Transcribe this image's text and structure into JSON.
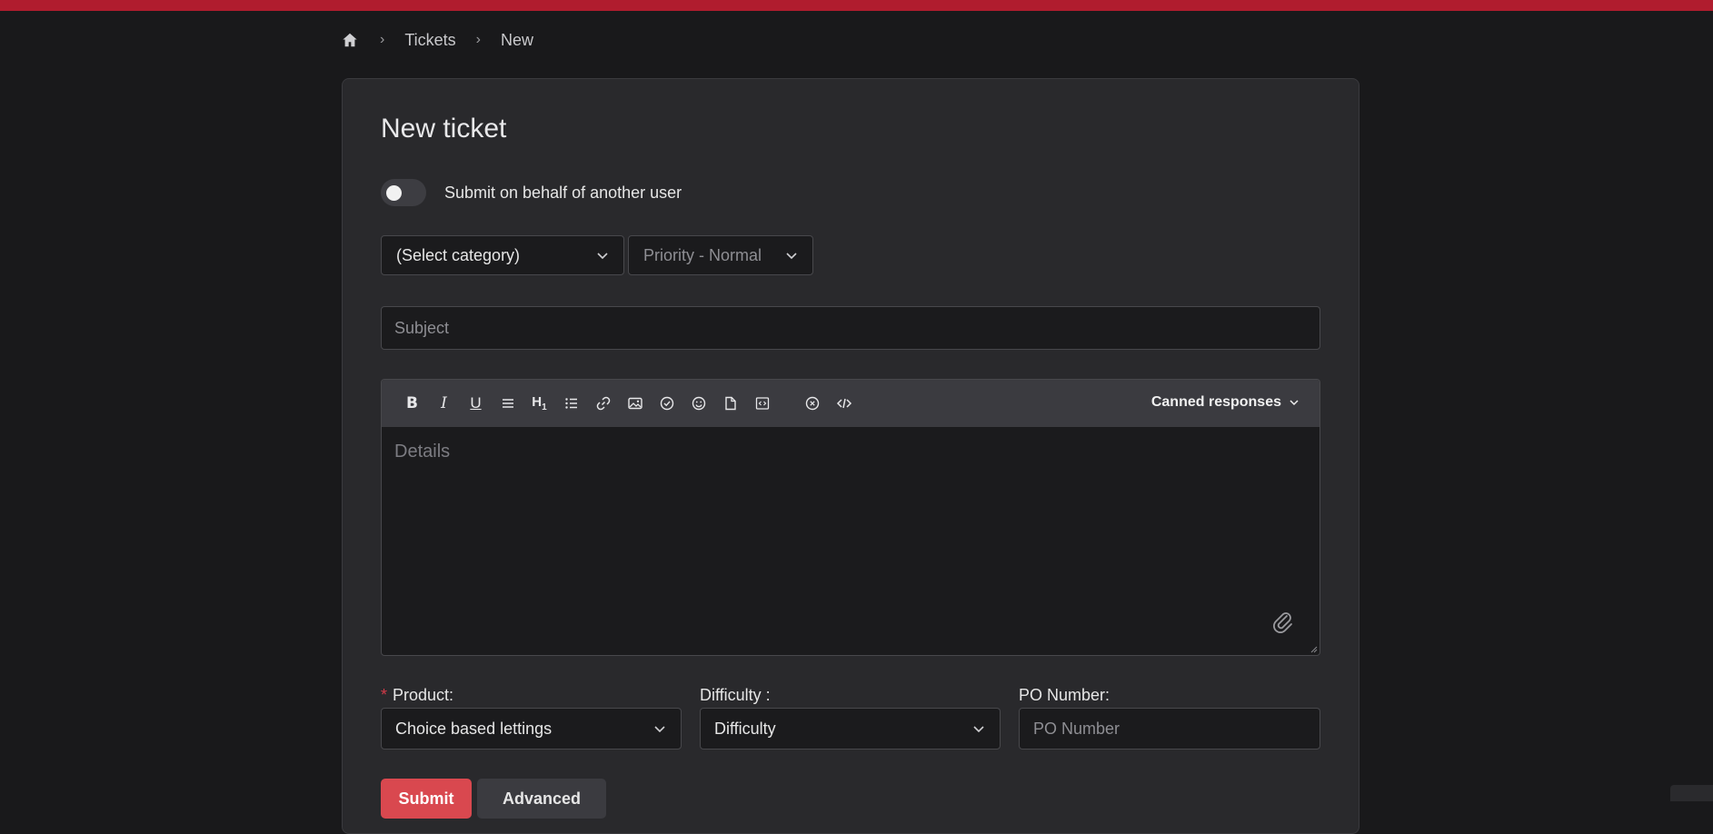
{
  "breadcrumb": {
    "items": [
      "Tickets",
      "New"
    ]
  },
  "form": {
    "title": "New ticket",
    "behalf_label": "Submit on behalf of another user",
    "category_value": "(Select category)",
    "priority_value": "Priority - Normal",
    "subject_placeholder": "Subject",
    "details_placeholder": "Details",
    "canned_label": "Canned responses",
    "toolbar_icons": [
      "bold-icon",
      "italic-icon",
      "underline-icon",
      "align-icon",
      "heading-icon",
      "bullet-list-icon",
      "link-icon",
      "image-icon",
      "checkmark-icon",
      "emoji-icon",
      "file-icon",
      "code-block-icon",
      "clear-format-icon",
      "source-code-icon"
    ],
    "product_label": "Product:",
    "product_value": "Choice based lettings",
    "difficulty_label": "Difficulty :",
    "difficulty_value": "Difficulty",
    "po_label": "PO Number:",
    "po_placeholder": "PO Number",
    "submit_label": "Submit",
    "advanced_label": "Advanced"
  },
  "colors": {
    "accent": "#b01c2e",
    "submit": "#d9484f",
    "background": "#19191b",
    "card": "#29292c"
  }
}
